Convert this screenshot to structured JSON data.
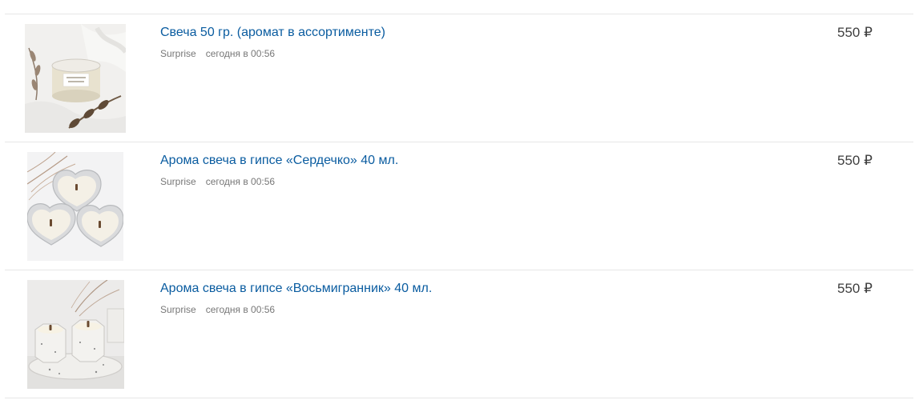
{
  "listings": [
    {
      "title": "Свеча 50 гр. (аромат в ассортименте)",
      "seller": "Surprise",
      "time": "сегодня в 00:56",
      "price": "550 ₽",
      "image_icon": "candle-jar-photo"
    },
    {
      "title": "Арома свеча в гипсе «Сердечко» 40 мл.",
      "seller": "Surprise",
      "time": "сегодня в 00:56",
      "price": "550 ₽",
      "image_icon": "heart-candles-photo"
    },
    {
      "title": "Арома свеча в гипсе «Восьмигранник» 40 мл.",
      "seller": "Surprise",
      "time": "сегодня в 00:56",
      "price": "550 ₽",
      "image_icon": "octagon-candles-photo"
    }
  ],
  "colors": {
    "title_link": "#0a5ca0",
    "meta_text": "#777777",
    "price_text": "#3d3d3d",
    "divider": "#e6e6e6"
  }
}
